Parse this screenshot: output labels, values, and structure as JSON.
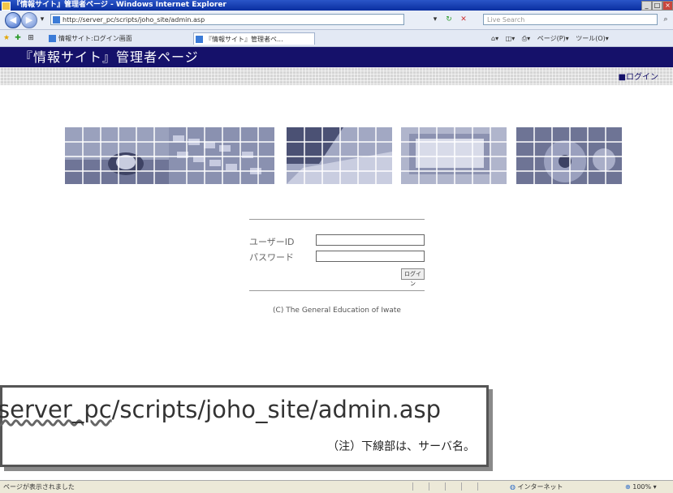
{
  "window": {
    "title": "『情報サイト』管理者ページ - Windows Internet Explorer"
  },
  "address_bar": {
    "url": "http://server_pc/scripts/joho_site/admin.asp",
    "search_placeholder": "Live Search"
  },
  "tabs": [
    {
      "label": "情報サイト:ログイン画面"
    },
    {
      "label": "『情報サイト』管理者ペ..."
    }
  ],
  "toolbar_right": {
    "page_label": "ページ(P)",
    "tools_label": "ツール(O)"
  },
  "page": {
    "header_title": "『情報サイト』管理者ページ",
    "login_link": "■ログイン",
    "form": {
      "user_id_label": "ユーザーID",
      "password_label": "パスワード",
      "submit_label": "ログイン"
    },
    "copyright": "(C) The General Education of Iwate"
  },
  "callout": {
    "url_underlined": "server_pc",
    "url_rest": "/scripts/joho_site/admin.asp",
    "note": "（注）下線部は、サーバ名。"
  },
  "status_bar": {
    "status_text": "ページが表示されました",
    "zone": "インターネット",
    "zoom": "100%"
  },
  "colors": {
    "header_bg": "#15116a",
    "photo_tint": "#8d95b4"
  }
}
